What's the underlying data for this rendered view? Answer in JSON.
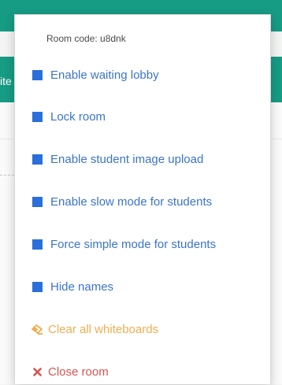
{
  "background": {
    "toolbar_text_fragment": "ite"
  },
  "menu": {
    "room_code_label": "Room code: u8dnk",
    "items": [
      {
        "label": "Enable waiting lobby"
      },
      {
        "label": "Lock room"
      },
      {
        "label": "Enable student image upload"
      },
      {
        "label": "Enable slow mode for students"
      },
      {
        "label": "Force simple mode for students"
      },
      {
        "label": "Hide names"
      },
      {
        "label": "Clear all whiteboards",
        "icon": "eraser-icon"
      },
      {
        "label": "Close room",
        "icon": "close-icon"
      }
    ]
  },
  "colors": {
    "brand_teal": "#169b84",
    "option_blue": "#3b74c9",
    "checkbox_blue": "#2a6fdb",
    "warning_orange": "#f0ad4e",
    "danger_red": "#d9534f"
  }
}
